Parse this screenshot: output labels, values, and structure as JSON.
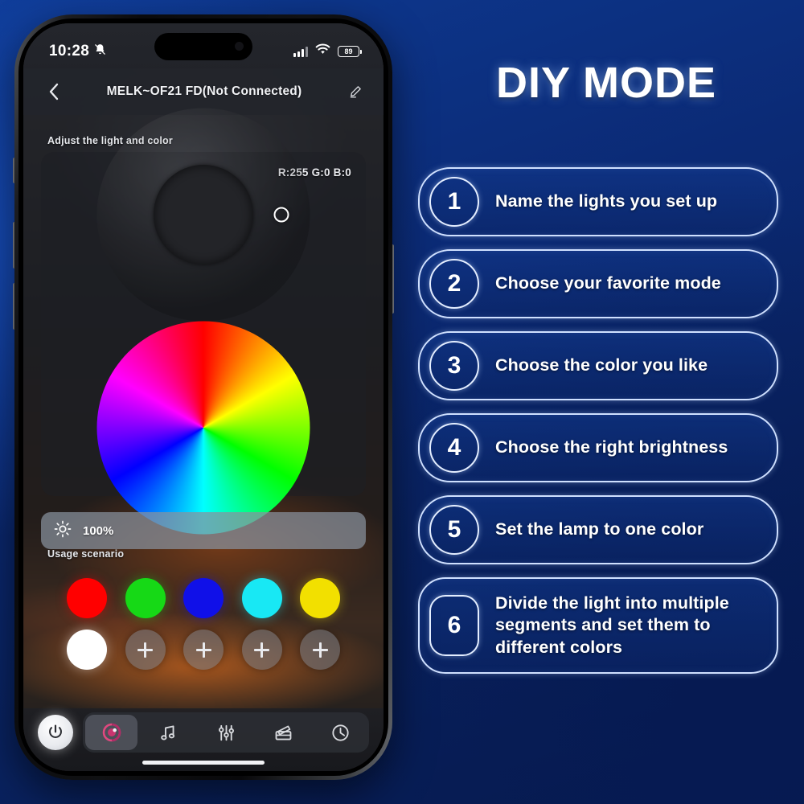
{
  "background": {
    "color_dark": "#081c5a",
    "color_light": "#174dba"
  },
  "phone": {
    "status_bar": {
      "time": "10:28",
      "silent_icon": "bell-slash-icon",
      "cellular_icon": "cellular-signal-icon",
      "wifi_icon": "wifi-icon",
      "battery_level": "89"
    },
    "nav": {
      "back_icon": "chevron-left-icon",
      "title": "MELK~OF21  FD(Not Connected)",
      "edit_icon": "pencil-icon"
    },
    "adjust_section_label": "Adjust the light and color",
    "color_panel": {
      "rgb_readout": "R:255 G:0 B:0",
      "wheel_icon": "color-wheel",
      "handle_hue_deg": 0,
      "selected_color": "#ff0000"
    },
    "brightness": {
      "icon": "brightness-sun-icon",
      "value": "100%"
    },
    "usage_section_label": "Usage scenario",
    "swatches": {
      "row1": [
        {
          "name": "red",
          "color": "#ff0000",
          "type": "color"
        },
        {
          "name": "green",
          "color": "#16d916",
          "type": "color"
        },
        {
          "name": "blue",
          "color": "#1010e8",
          "type": "color"
        },
        {
          "name": "cyan",
          "color": "#18e8f4",
          "type": "color"
        },
        {
          "name": "yellow",
          "color": "#f2e000",
          "type": "color"
        }
      ],
      "row2": [
        {
          "name": "white",
          "color": "#ffffff",
          "type": "color"
        },
        {
          "name": "add-1",
          "color": "",
          "type": "add"
        },
        {
          "name": "add-2",
          "color": "",
          "type": "add"
        },
        {
          "name": "add-3",
          "color": "",
          "type": "add"
        },
        {
          "name": "add-4",
          "color": "",
          "type": "add"
        }
      ]
    },
    "tabbar": {
      "power_icon": "power-icon",
      "tabs": [
        {
          "icon": "color-wheel-icon",
          "active": true
        },
        {
          "icon": "music-note-icon",
          "active": false
        },
        {
          "icon": "equalizer-icon",
          "active": false
        },
        {
          "icon": "scene-icon",
          "active": false
        },
        {
          "icon": "timer-clock-icon",
          "active": false
        }
      ]
    }
  },
  "panel": {
    "title": "DIY MODE",
    "steps": [
      {
        "number": "1",
        "text": "Name the lights you set up"
      },
      {
        "number": "2",
        "text": "Choose your favorite mode"
      },
      {
        "number": "3",
        "text": "Choose the color you like"
      },
      {
        "number": "4",
        "text": "Choose the right brightness"
      },
      {
        "number": "5",
        "text": "Set the lamp to one color"
      },
      {
        "number": "6",
        "text": "Divide the light into multiple segments and set them to different colors"
      }
    ]
  }
}
